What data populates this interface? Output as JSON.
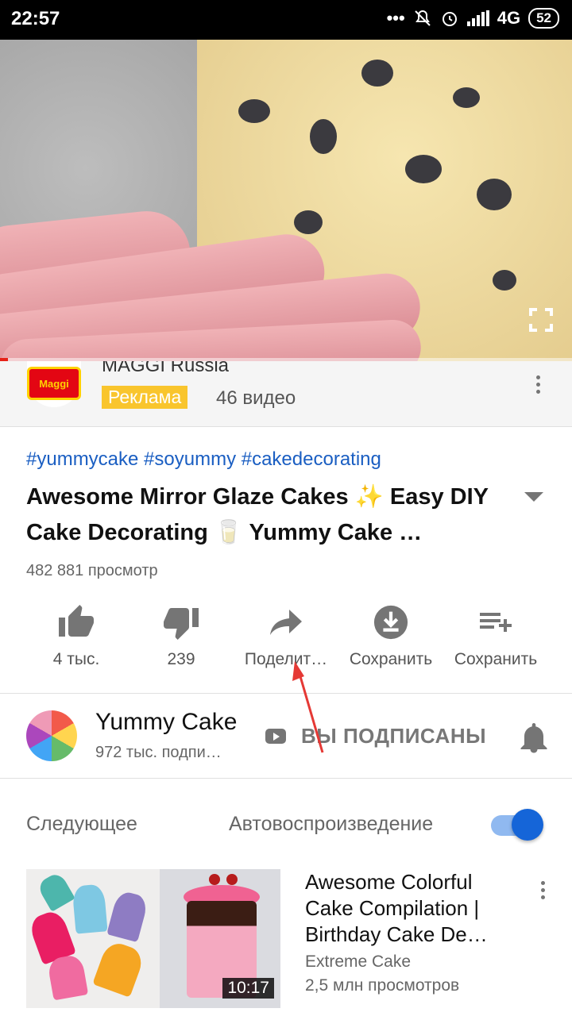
{
  "status_bar": {
    "time": "22:57",
    "network": "4G",
    "battery": "52"
  },
  "ad": {
    "channel": "MAGGI Russia",
    "badge": "Реклама",
    "video_count": "46 видео",
    "logo_text": "Maggi"
  },
  "video": {
    "hashtags": "#yummycake #soyummy #cakedecorating",
    "title": "Awesome Mirror Glaze Cakes ✨ Easy DIY Cake Decorating 🥛 Yummy Cake …",
    "views": "482 881 просмотр",
    "progress": 0.014
  },
  "actions": [
    {
      "label": "4 тыс.",
      "icon": "thumb-up-icon"
    },
    {
      "label": "239",
      "icon": "thumb-down-icon"
    },
    {
      "label": "Поделит…",
      "icon": "share-icon"
    },
    {
      "label": "Сохранить",
      "icon": "download-icon"
    },
    {
      "label": "Сохранить",
      "icon": "playlist-add-icon"
    }
  ],
  "channel": {
    "name": "Yummy Cake",
    "subscribers": "972 тыс. подпи…",
    "subscribe_label": "ВЫ ПОДПИСАНЫ"
  },
  "up_next": {
    "header": "Следующее",
    "autoplay_label": "Автовоспроизведение",
    "autoplay_on": true,
    "item": {
      "title": "Awesome Colorful Cake Compilation | Birthday Cake De…",
      "channel": "Extreme Cake",
      "views": "2,5 млн просмотров",
      "duration": "10:17"
    }
  },
  "colors": {
    "accent": "#1565d8",
    "ad_badge": "#f9c52d",
    "hashtag": "#1a5ec2",
    "annotation_arrow": "#e53935"
  }
}
